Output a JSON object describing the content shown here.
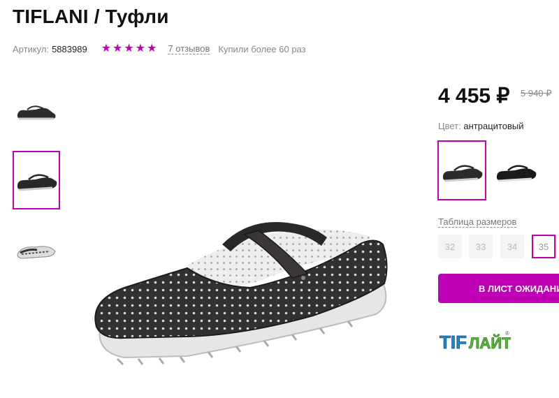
{
  "product": {
    "title": "TIFLANI / Туфли",
    "article_label": "Артикул:",
    "article_value": "5883989",
    "rating_stars": 5,
    "reviews_label": "7 отзывов",
    "bought_label": "Купили более 60 раз"
  },
  "pricing": {
    "price": "4 455 ₽",
    "old_price": "5 940 ₽"
  },
  "color": {
    "label": "Цвет:",
    "value": "антрацитовый"
  },
  "sizes": {
    "table_label": "Таблица размеров",
    "options": [
      "32",
      "33",
      "34",
      "35"
    ],
    "selected": "35"
  },
  "actions": {
    "waitlist_button": "В ЛИСТ ОЖИДАНИЯ"
  },
  "brand_logo": {
    "part1": "TIF",
    "part2": "ЛАЙТ",
    "mark": "®"
  },
  "colors": {
    "accent": "#c000b5",
    "star": "#c000b5"
  }
}
